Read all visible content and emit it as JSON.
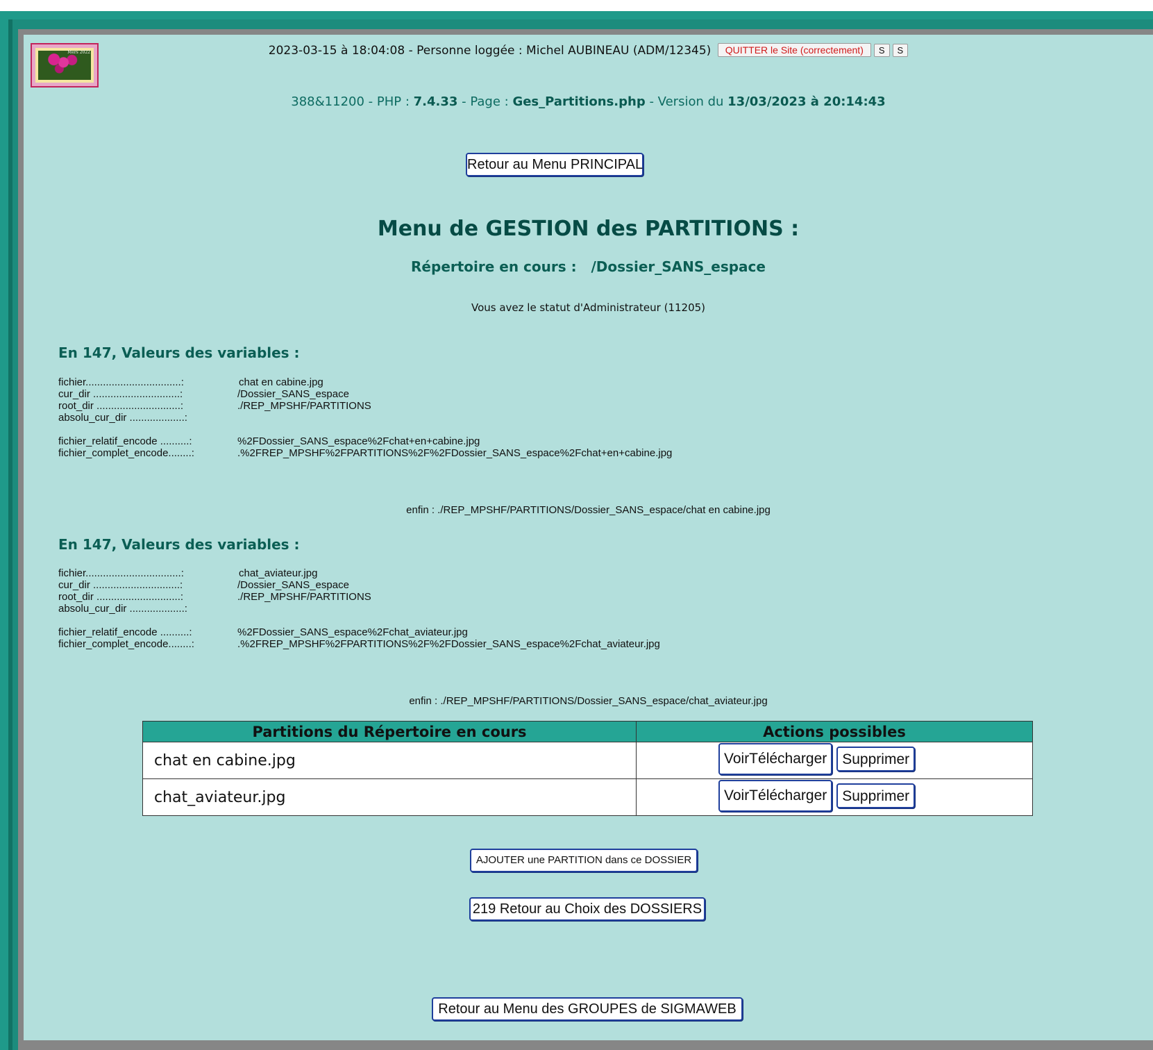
{
  "header": {
    "timestamp": "2023-03-15 à 18:04:08",
    "separator": " - ",
    "user_label": "Personne loggée : Michel AUBINEAU (ADM/12345)",
    "quit_label": "QUITTER le Site (correctement)",
    "s1_label": "S",
    "s2_label": "S"
  },
  "logo": {
    "caption": "Mers 2022"
  },
  "version_line": {
    "prefix": "388&11200 - PHP : ",
    "php_version": "7.4.33",
    "page_label": " - Page : ",
    "page_name": "Ges_Partitions.php",
    "version_label": " - Version du ",
    "version_date": "13/03/2023 à 20:14:43"
  },
  "buttons": {
    "back_main": "Retour au Menu PRINCIPAL",
    "add_partition": "AJOUTER une PARTITION dans ce DOSSIER",
    "back_folders": "219 Retour au Choix des DOSSIERS",
    "back_groups": "Retour au Menu des GROUPES de SIGMAWEB"
  },
  "title": "Menu de GESTION des PARTITIONS :",
  "current_dir": "Répertoire en cours :   /Dossier_SANS_espace",
  "status": "Vous avez le statut d'Administrateur (11205)",
  "var_blocks": [
    {
      "heading": "En 147, Valeurs des variables :",
      "rows": [
        {
          "label": "fichier.................................:",
          "value": "chat en cabine.jpg"
        },
        {
          "label": "cur_dir ..............................:",
          "value": "/Dossier_SANS_espace"
        },
        {
          "label": "root_dir .............................:",
          "value": "./REP_MPSHF/PARTITIONS"
        },
        {
          "label": "absolu_cur_dir ...................:",
          "value": ""
        },
        {
          "label": "fichier_relatif_encode ..........:",
          "value": "%2FDossier_SANS_espace%2Fchat+en+cabine.jpg"
        },
        {
          "label": "fichier_complet_encode........:",
          "value": ".%2FREP_MPSHF%2FPARTITIONS%2F%2FDossier_SANS_espace%2Fchat+en+cabine.jpg"
        }
      ],
      "enfin": "enfin : ./REP_MPSHF/PARTITIONS/Dossier_SANS_espace/chat en cabine.jpg"
    },
    {
      "heading": "En 147, Valeurs des variables :",
      "rows": [
        {
          "label": "fichier.................................:",
          "value": "chat_aviateur.jpg"
        },
        {
          "label": "cur_dir ..............................:",
          "value": "/Dossier_SANS_espace"
        },
        {
          "label": "root_dir .............................:",
          "value": "./REP_MPSHF/PARTITIONS"
        },
        {
          "label": "absolu_cur_dir ...................:",
          "value": ""
        },
        {
          "label": "fichier_relatif_encode ..........:",
          "value": "%2FDossier_SANS_espace%2Fchat_aviateur.jpg"
        },
        {
          "label": "fichier_complet_encode........:",
          "value": ".%2FREP_MPSHF%2FPARTITIONS%2F%2FDossier_SANS_espace%2Fchat_aviateur.jpg"
        }
      ],
      "enfin": "enfin : ./REP_MPSHF/PARTITIONS/Dossier_SANS_espace/chat_aviateur.jpg"
    }
  ],
  "table": {
    "headers": [
      "Partitions du Répertoire en cours",
      "Actions possibles"
    ],
    "rows": [
      {
        "file": "chat en cabine.jpg",
        "view_label": "VoirTélécharger",
        "delete_label": "Supprimer"
      },
      {
        "file": "chat_aviateur.jpg",
        "view_label": "VoirTélécharger",
        "delete_label": "Supprimer"
      }
    ]
  },
  "colors": {
    "frame": "#1f9a8a",
    "background": "#b3dfdc",
    "table_header": "#25a595",
    "heading_text": "#064b45",
    "quit_text": "#d01a1a"
  }
}
